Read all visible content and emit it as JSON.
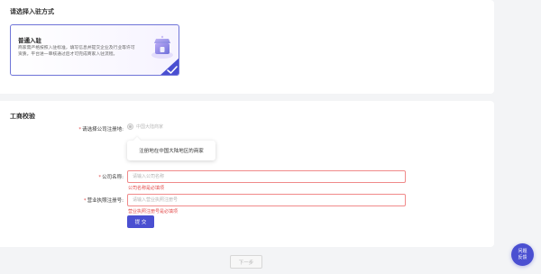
{
  "entry_section": {
    "title": "请选择入驻方式",
    "option": {
      "title": "普通入驻",
      "description": "商家需严格按照入驻标准，填写信息并提交企业及行业等许可资质。平台进一审核通过后才可完成商家入驻流程。",
      "selected": true
    }
  },
  "business_section": {
    "title": "工商校验",
    "registration_location": {
      "label": "请选择公司注册地",
      "option_label": "中国大陆商家",
      "tooltip": "注册地在中国大陆地区的商家"
    },
    "company_name": {
      "label": "公司名称",
      "placeholder": "请输入公司名称",
      "error": "公司名称是必填项"
    },
    "license_number": {
      "label": "营业执照注册号",
      "placeholder": "请输入营业执照注册号",
      "error": "营业执照注册号是必填项"
    },
    "submit_label": "提 交"
  },
  "footer": {
    "next_label": "下一步"
  },
  "feedback": {
    "line1": "问题",
    "line2": "反馈"
  },
  "colors": {
    "accent": "#4a4fd1",
    "error": "#e34d4d",
    "error_border": "#f08a8a"
  }
}
